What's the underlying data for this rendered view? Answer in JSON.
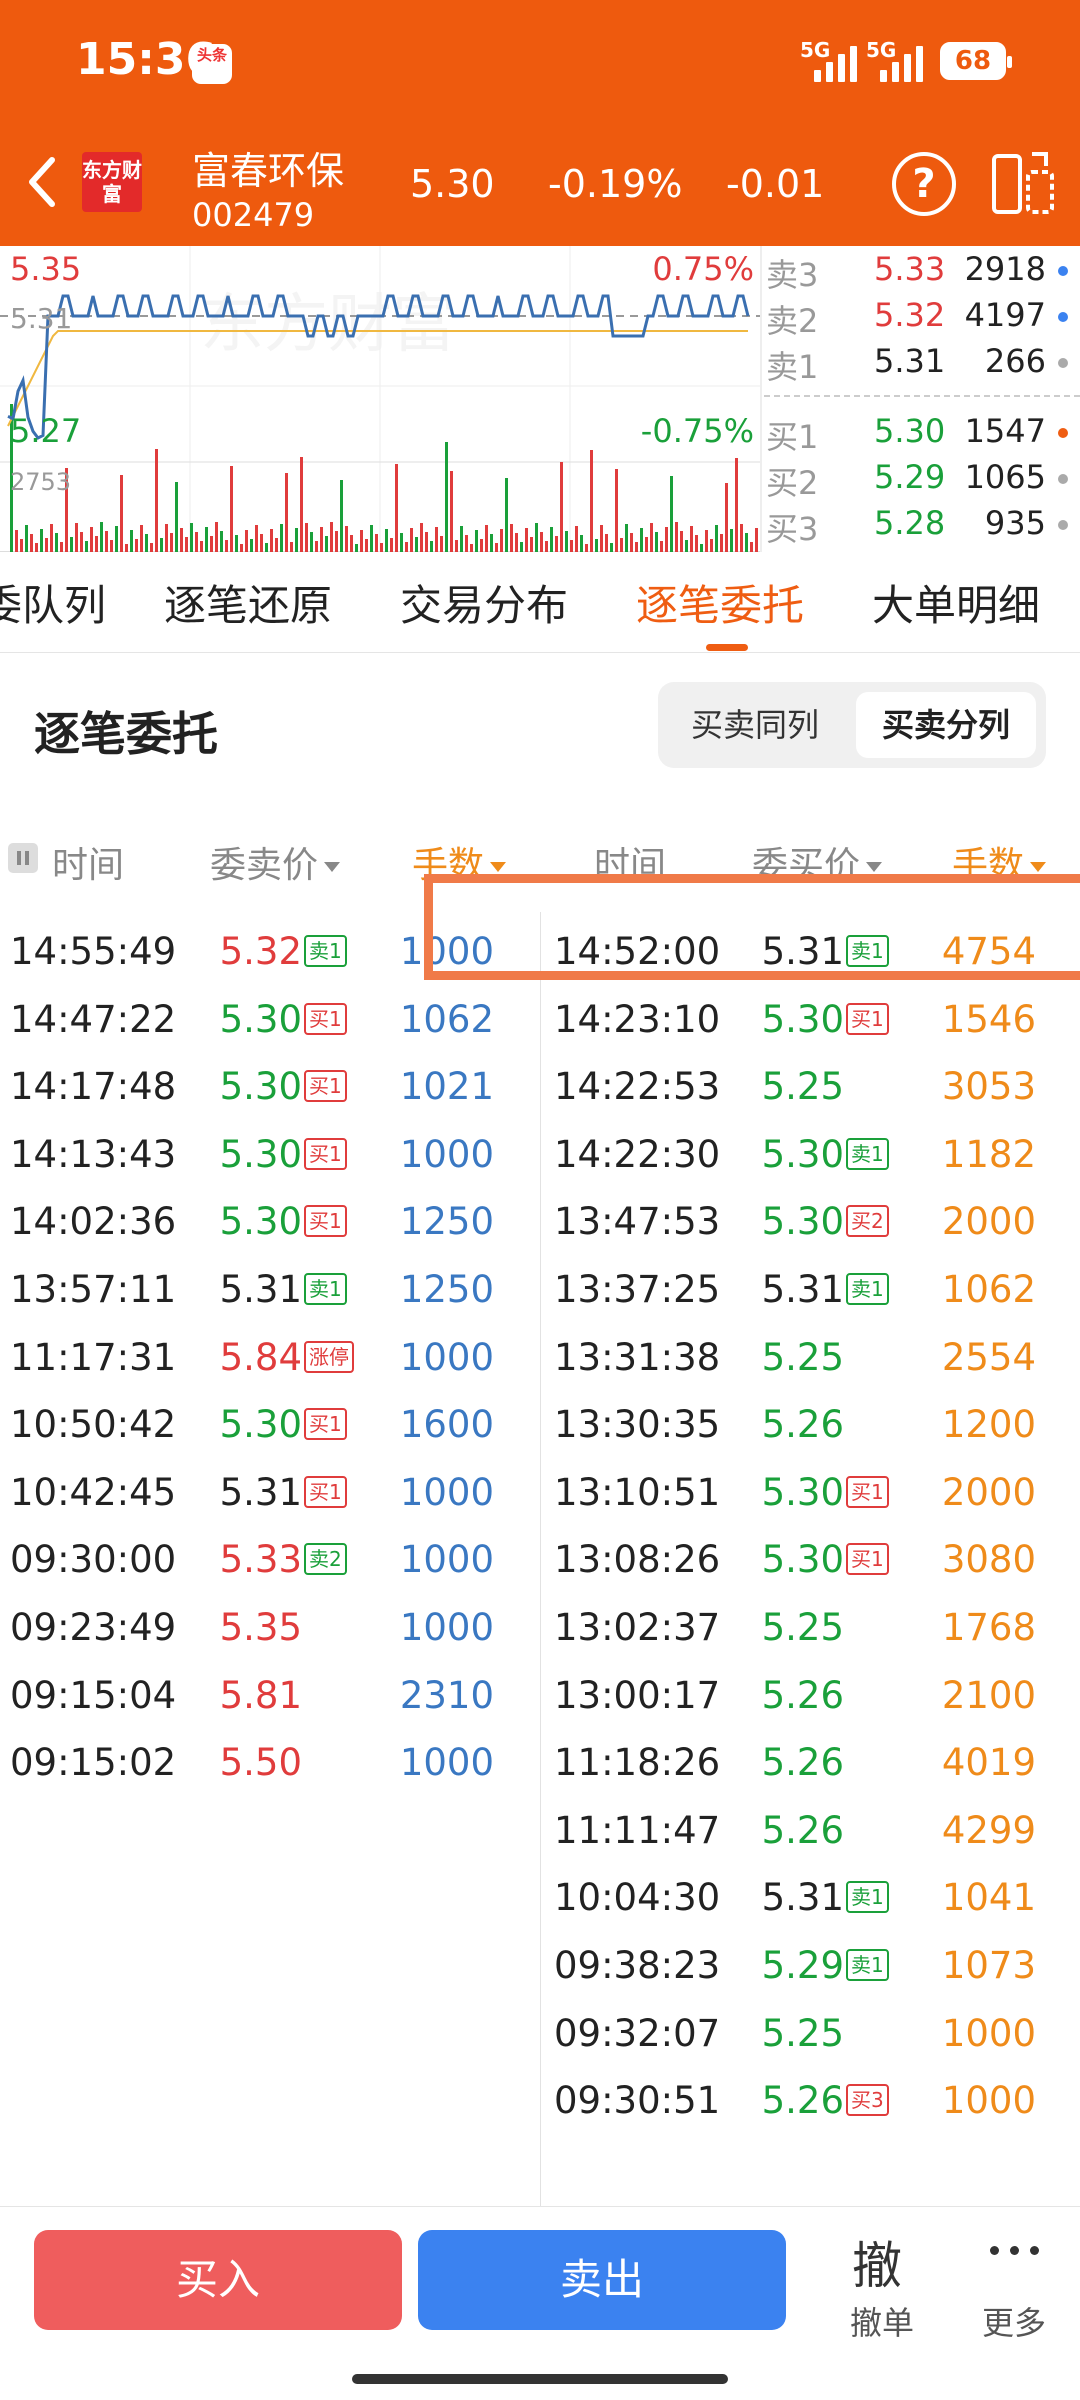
{
  "status": {
    "time": "15:36",
    "app_badge": "头条",
    "signal_label": "5G",
    "battery": "68"
  },
  "header": {
    "logo_text": "东方财富",
    "stock_name": "富春环保",
    "stock_code": "002479",
    "price": "5.30",
    "change_pct": "-0.19%",
    "change": "-0.01"
  },
  "mini_chart": {
    "type": "line",
    "price_high_label": "5.35",
    "price_low_label": "5.27",
    "price_mid_label": "5.31",
    "pct_high_label": "0.75%",
    "pct_low_label": "-0.75%",
    "volume_max_label": "2753",
    "watermark": "东方财富"
  },
  "order_book": {
    "sells": [
      {
        "label": "卖3",
        "price": "5.33",
        "volume": "2918",
        "dot": "#3b82f0"
      },
      {
        "label": "卖2",
        "price": "5.32",
        "volume": "4197",
        "dot": "#3b82f0"
      },
      {
        "label": "卖1",
        "price": "5.31",
        "volume": "266",
        "dot": "#aaaaaa"
      }
    ],
    "buys": [
      {
        "label": "买1",
        "price": "5.30",
        "volume": "1547",
        "dot": "#ef5d12"
      },
      {
        "label": "买2",
        "price": "5.29",
        "volume": "1065",
        "dot": "#aaaaaa"
      },
      {
        "label": "买3",
        "price": "5.28",
        "volume": "935",
        "dot": "#aaaaaa"
      }
    ]
  },
  "tabs": [
    "委队列",
    "逐笔还原",
    "交易分布",
    "逐笔委托",
    "大单明细"
  ],
  "active_tab": "逐笔委托",
  "section": {
    "title": "逐笔委托",
    "seg_same": "买卖同列",
    "seg_split": "买卖分列"
  },
  "table_header": {
    "left_time": "时间",
    "left_price": "委卖价",
    "left_qty": "手数",
    "right_time": "时间",
    "right_price": "委买价",
    "right_qty": "手数"
  },
  "colors": {
    "red": "#e03c3c",
    "green": "#1aa03a",
    "black": "#222222",
    "blue": "#3a78c2",
    "orange": "#ef8b1a"
  },
  "sell_orders": [
    {
      "time": "14:55:49",
      "price": "5.32",
      "pc": "red",
      "tag": "卖1",
      "tc": "g",
      "qty": "1000"
    },
    {
      "time": "14:47:22",
      "price": "5.30",
      "pc": "green",
      "tag": "买1",
      "tc": "r",
      "qty": "1062"
    },
    {
      "time": "14:17:48",
      "price": "5.30",
      "pc": "green",
      "tag": "买1",
      "tc": "r",
      "qty": "1021"
    },
    {
      "time": "14:13:43",
      "price": "5.30",
      "pc": "green",
      "tag": "买1",
      "tc": "r",
      "qty": "1000"
    },
    {
      "time": "14:02:36",
      "price": "5.30",
      "pc": "green",
      "tag": "买1",
      "tc": "r",
      "qty": "1250"
    },
    {
      "time": "13:57:11",
      "price": "5.31",
      "pc": "black",
      "tag": "卖1",
      "tc": "g",
      "qty": "1250"
    },
    {
      "time": "11:17:31",
      "price": "5.84",
      "pc": "red",
      "tag": "涨停",
      "tc": "r",
      "qty": "1000"
    },
    {
      "time": "10:50:42",
      "price": "5.30",
      "pc": "green",
      "tag": "买1",
      "tc": "r",
      "qty": "1600"
    },
    {
      "time": "10:42:45",
      "price": "5.31",
      "pc": "black",
      "tag": "买1",
      "tc": "r",
      "qty": "1000"
    },
    {
      "time": "09:30:00",
      "price": "5.33",
      "pc": "red",
      "tag": "卖2",
      "tc": "g",
      "qty": "1000"
    },
    {
      "time": "09:23:49",
      "price": "5.35",
      "pc": "red",
      "tag": "",
      "tc": "",
      "qty": "1000"
    },
    {
      "time": "09:15:04",
      "price": "5.81",
      "pc": "red",
      "tag": "",
      "tc": "",
      "qty": "2310"
    },
    {
      "time": "09:15:02",
      "price": "5.50",
      "pc": "red",
      "tag": "",
      "tc": "",
      "qty": "1000"
    }
  ],
  "buy_orders": [
    {
      "time": "14:52:00",
      "price": "5.31",
      "pc": "black",
      "tag": "卖1",
      "tc": "g",
      "qty": "4754"
    },
    {
      "time": "14:23:10",
      "price": "5.30",
      "pc": "green",
      "tag": "买1",
      "tc": "r",
      "qty": "1546"
    },
    {
      "time": "14:22:53",
      "price": "5.25",
      "pc": "green",
      "tag": "",
      "tc": "",
      "qty": "3053"
    },
    {
      "time": "14:22:30",
      "price": "5.30",
      "pc": "green",
      "tag": "卖1",
      "tc": "g",
      "qty": "1182"
    },
    {
      "time": "13:47:53",
      "price": "5.30",
      "pc": "green",
      "tag": "买2",
      "tc": "r",
      "qty": "2000"
    },
    {
      "time": "13:37:25",
      "price": "5.31",
      "pc": "black",
      "tag": "卖1",
      "tc": "g",
      "qty": "1062"
    },
    {
      "time": "13:31:38",
      "price": "5.25",
      "pc": "green",
      "tag": "",
      "tc": "",
      "qty": "2554"
    },
    {
      "time": "13:30:35",
      "price": "5.26",
      "pc": "green",
      "tag": "",
      "tc": "",
      "qty": "1200"
    },
    {
      "time": "13:10:51",
      "price": "5.30",
      "pc": "green",
      "tag": "买1",
      "tc": "r",
      "qty": "2000"
    },
    {
      "time": "13:08:26",
      "price": "5.30",
      "pc": "green",
      "tag": "买1",
      "tc": "r",
      "qty": "3080"
    },
    {
      "time": "13:02:37",
      "price": "5.25",
      "pc": "green",
      "tag": "",
      "tc": "",
      "qty": "1768"
    },
    {
      "time": "13:00:17",
      "price": "5.26",
      "pc": "green",
      "tag": "",
      "tc": "",
      "qty": "2100"
    },
    {
      "time": "11:18:26",
      "price": "5.26",
      "pc": "green",
      "tag": "",
      "tc": "",
      "qty": "4019"
    },
    {
      "time": "11:11:47",
      "price": "5.26",
      "pc": "green",
      "tag": "",
      "tc": "",
      "qty": "4299"
    },
    {
      "time": "10:04:30",
      "price": "5.31",
      "pc": "black",
      "tag": "卖1",
      "tc": "g",
      "qty": "1041"
    },
    {
      "time": "09:38:23",
      "price": "5.29",
      "pc": "green",
      "tag": "卖1",
      "tc": "g",
      "qty": "1073"
    },
    {
      "time": "09:32:07",
      "price": "5.25",
      "pc": "green",
      "tag": "",
      "tc": "",
      "qty": "1000"
    },
    {
      "time": "09:30:51",
      "price": "5.26",
      "pc": "green",
      "tag": "买3",
      "tc": "r",
      "qty": "1000"
    }
  ],
  "bottom": {
    "buy": "买入",
    "sell": "卖出",
    "cancel_icon": "撤",
    "cancel": "撤单",
    "more": "更多"
  }
}
